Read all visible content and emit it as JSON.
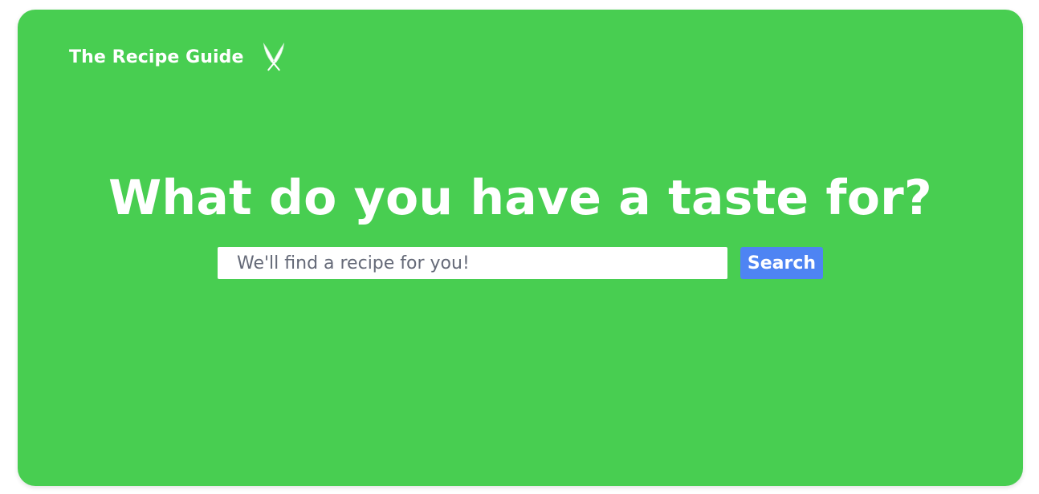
{
  "brand": {
    "title": "The Recipe Guide",
    "icon": "crossed-knives-icon"
  },
  "hero": {
    "headline": "What do you have a taste for?"
  },
  "search": {
    "placeholder": "We'll find a recipe for you!",
    "value": "",
    "button_label": "Search"
  },
  "colors": {
    "background": "#48ce51",
    "button": "#4e84f3",
    "text": "#ffffff"
  }
}
